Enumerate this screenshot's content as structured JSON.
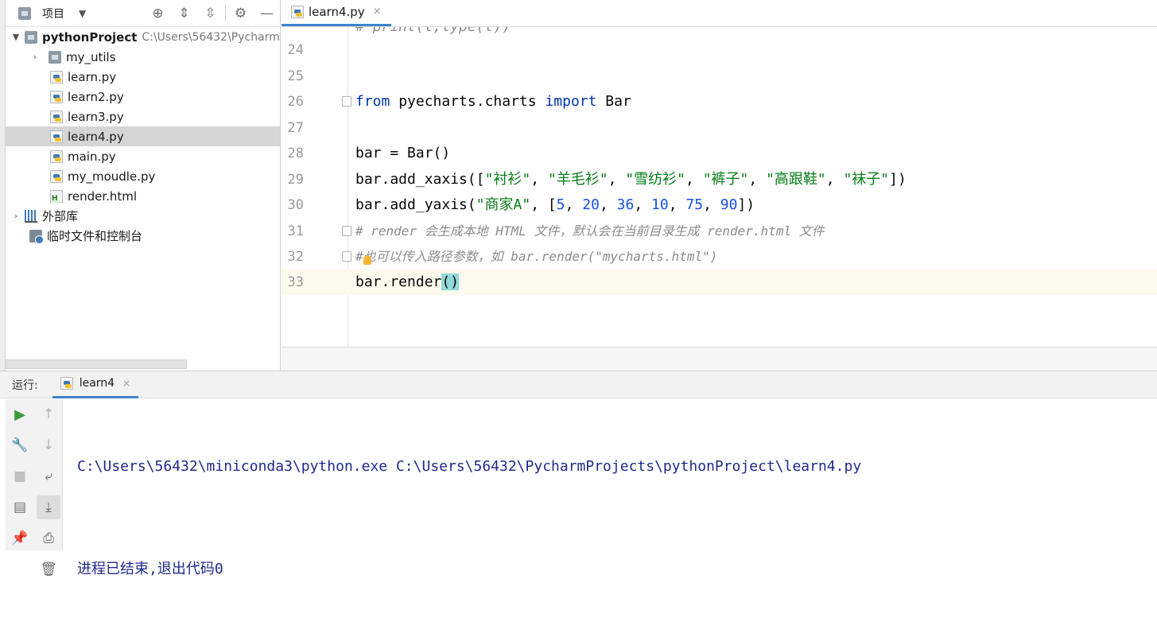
{
  "project_panel": {
    "title": "项目",
    "root": {
      "name": "pythonProject",
      "path": "C:\\Users\\56432\\Pycharm"
    },
    "items": [
      {
        "label": "my_utils",
        "type": "folder"
      },
      {
        "label": "learn.py",
        "type": "py"
      },
      {
        "label": "learn2.py",
        "type": "py"
      },
      {
        "label": "learn3.py",
        "type": "py"
      },
      {
        "label": "learn4.py",
        "type": "py",
        "selected": true
      },
      {
        "label": "main.py",
        "type": "py"
      },
      {
        "label": "my_moudle.py",
        "type": "py"
      },
      {
        "label": "render.html",
        "type": "html"
      }
    ],
    "external_libs": "外部库",
    "scratches": "临时文件和控制台"
  },
  "editor": {
    "tab": {
      "label": "learn4.py",
      "close": "×"
    },
    "partial_top_line": "# print(t,type(t))",
    "line_numbers": [
      "24",
      "25",
      "26",
      "27",
      "28",
      "29",
      "30",
      "31",
      "32",
      "33"
    ],
    "code": {
      "l26": {
        "kw_from": "from",
        "mid": " pyecharts.charts ",
        "kw_import": "import",
        "end": " Bar"
      },
      "l28": "bar = Bar()",
      "l29": {
        "a": "bar.add_xaxis([",
        "s1": "\"衬衫\"",
        "s2": "\"羊毛衫\"",
        "s3": "\"雪纺衫\"",
        "s4": "\"裤子\"",
        "s5": "\"高跟鞋\"",
        "s6": "\"袜子\"",
        "end": "])"
      },
      "l30": {
        "a": "bar.add_yaxis(",
        "s1": "\"商家A\"",
        "b": ", [",
        "n1": "5",
        "n2": "20",
        "n3": "36",
        "n4": "10",
        "n5": "75",
        "n6": "90",
        "end": "])"
      },
      "l31": "# render 会生成本地 HTML 文件，默认会在当前目录生成 render.html 文件",
      "l32": "#也可以传入路径参数，如 bar.render(\"mycharts.html\")",
      "l33": {
        "a": "bar.render",
        "b": "()"
      }
    }
  },
  "run_panel": {
    "label": "运行:",
    "tab": "learn4",
    "tab_close": "×",
    "console_lines": [
      "C:\\Users\\56432\\miniconda3\\python.exe C:\\Users\\56432\\PycharmProjects\\pythonProject\\learn4.py",
      "进程已结束,退出代码0"
    ]
  },
  "icons": {
    "project": "project-icon",
    "locate": "crosshair-icon",
    "expand": "expand-all-icon",
    "collapse": "collapse-all-icon",
    "settings": "gear-icon",
    "hide": "minimize-icon"
  }
}
